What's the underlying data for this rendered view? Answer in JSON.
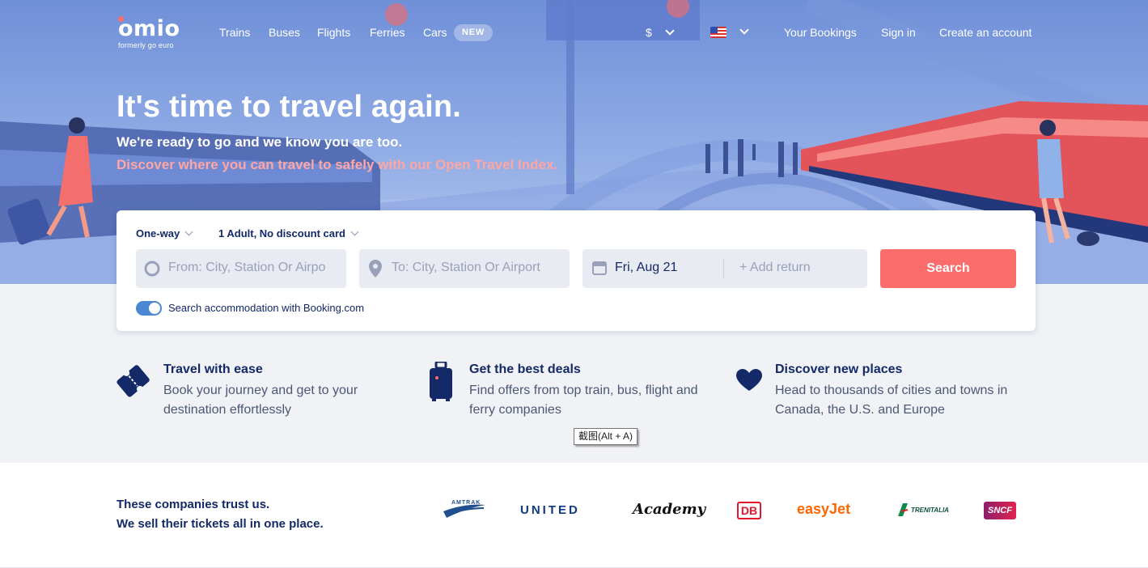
{
  "nav": {
    "logo": "omio",
    "logo_sub": "formerly go euro",
    "links": [
      "Trains",
      "Buses",
      "Flights",
      "Ferries",
      "Cars"
    ],
    "new_badge": "NEW",
    "currency": "$",
    "bookings": "Your Bookings",
    "sign_in": "Sign in",
    "create_account": "Create an account"
  },
  "hero": {
    "title": "It's time to travel again.",
    "subtitle": "We're ready to go and we know you are too.",
    "tagline": "Discover where you can travel to safely with our Open Travel Index."
  },
  "search": {
    "trip_type": "One-way",
    "passengers": "1 Adult, No discount card",
    "from_placeholder": "From: City, Station Or Airpo",
    "to_placeholder": "To: City, Station Or Airport",
    "date": "Fri, Aug 21",
    "add_return": "+ Add return",
    "button": "Search",
    "accommodation": "Search accommodation with Booking.com"
  },
  "features": [
    {
      "title": "Travel with ease",
      "text": "Book your journey and get to your destination effortlessly"
    },
    {
      "title": "Get the best deals",
      "text": "Find offers from top train, bus, flight and ferry companies"
    },
    {
      "title": "Discover new places",
      "text": "Head to thousands of cities and towns in Canada, the U.S. and Europe"
    }
  ],
  "tooltip": "截图(Alt + A)",
  "trust": {
    "line1": "These companies trust us.",
    "line2": "We sell their tickets all in one place.",
    "brands": [
      "AMTRAK",
      "UNITED",
      "Academy",
      "DB",
      "easyJet",
      "TRENITALIA",
      "SNCF"
    ]
  },
  "colors": {
    "accent": "#fc6c6b",
    "navy": "#132968",
    "toggle": "#4b87d3",
    "hero_blue": "#7b98dd"
  }
}
